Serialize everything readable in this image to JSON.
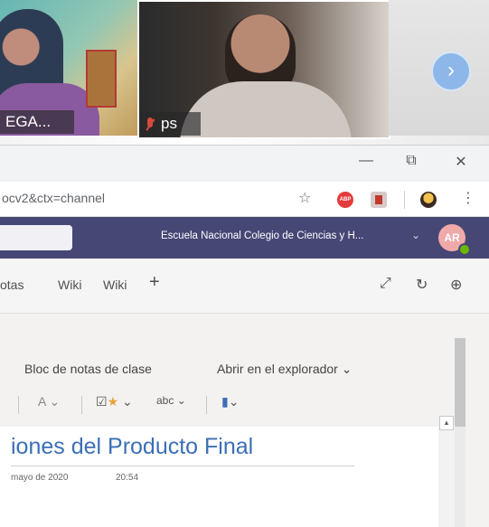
{
  "video_call": {
    "participants": [
      {
        "name": "EGA..."
      },
      {
        "name": "ps",
        "mic": "muted"
      }
    ],
    "next_label": "›"
  },
  "browser": {
    "window_controls": {
      "minimize": "—",
      "restore": "⧉",
      "close": "✕"
    },
    "url": "ocv2&ctx=channel",
    "extensions": [
      {
        "name": "abp-icon",
        "text": "ABP"
      },
      {
        "name": "pdf-icon"
      },
      {
        "name": "profile-extension-icon"
      }
    ],
    "menu_icon": "⋮"
  },
  "teams_header": {
    "org_name": "Escuela Nacional Colegio de Ciencias y H...",
    "org_chevron": "⌄",
    "avatar_initials": "AR",
    "colors": {
      "header": "#464775",
      "presence": "#6bb700",
      "avatar": "#f0a9a9"
    }
  },
  "tabs": {
    "items": [
      {
        "label": "otas"
      },
      {
        "label": "Wiki"
      },
      {
        "label": "Wiki"
      }
    ],
    "add_label": "+",
    "expand_icon": "⤢",
    "reload_icon": "↻",
    "globe_icon": "⊕"
  },
  "onenote": {
    "menu": {
      "notebook": "Bloc de notas de clase",
      "open_browser": "Abrir en el explorador",
      "open_chevron": "⌄"
    },
    "toolbar": {
      "font_color": "A",
      "tags": "☑",
      "spelling": "abc",
      "immersive": "⌄"
    },
    "page": {
      "title": "iones del Producto Final",
      "date": "mayo de 2020",
      "time": "20:54",
      "title_color": "#3b6fb6"
    }
  }
}
